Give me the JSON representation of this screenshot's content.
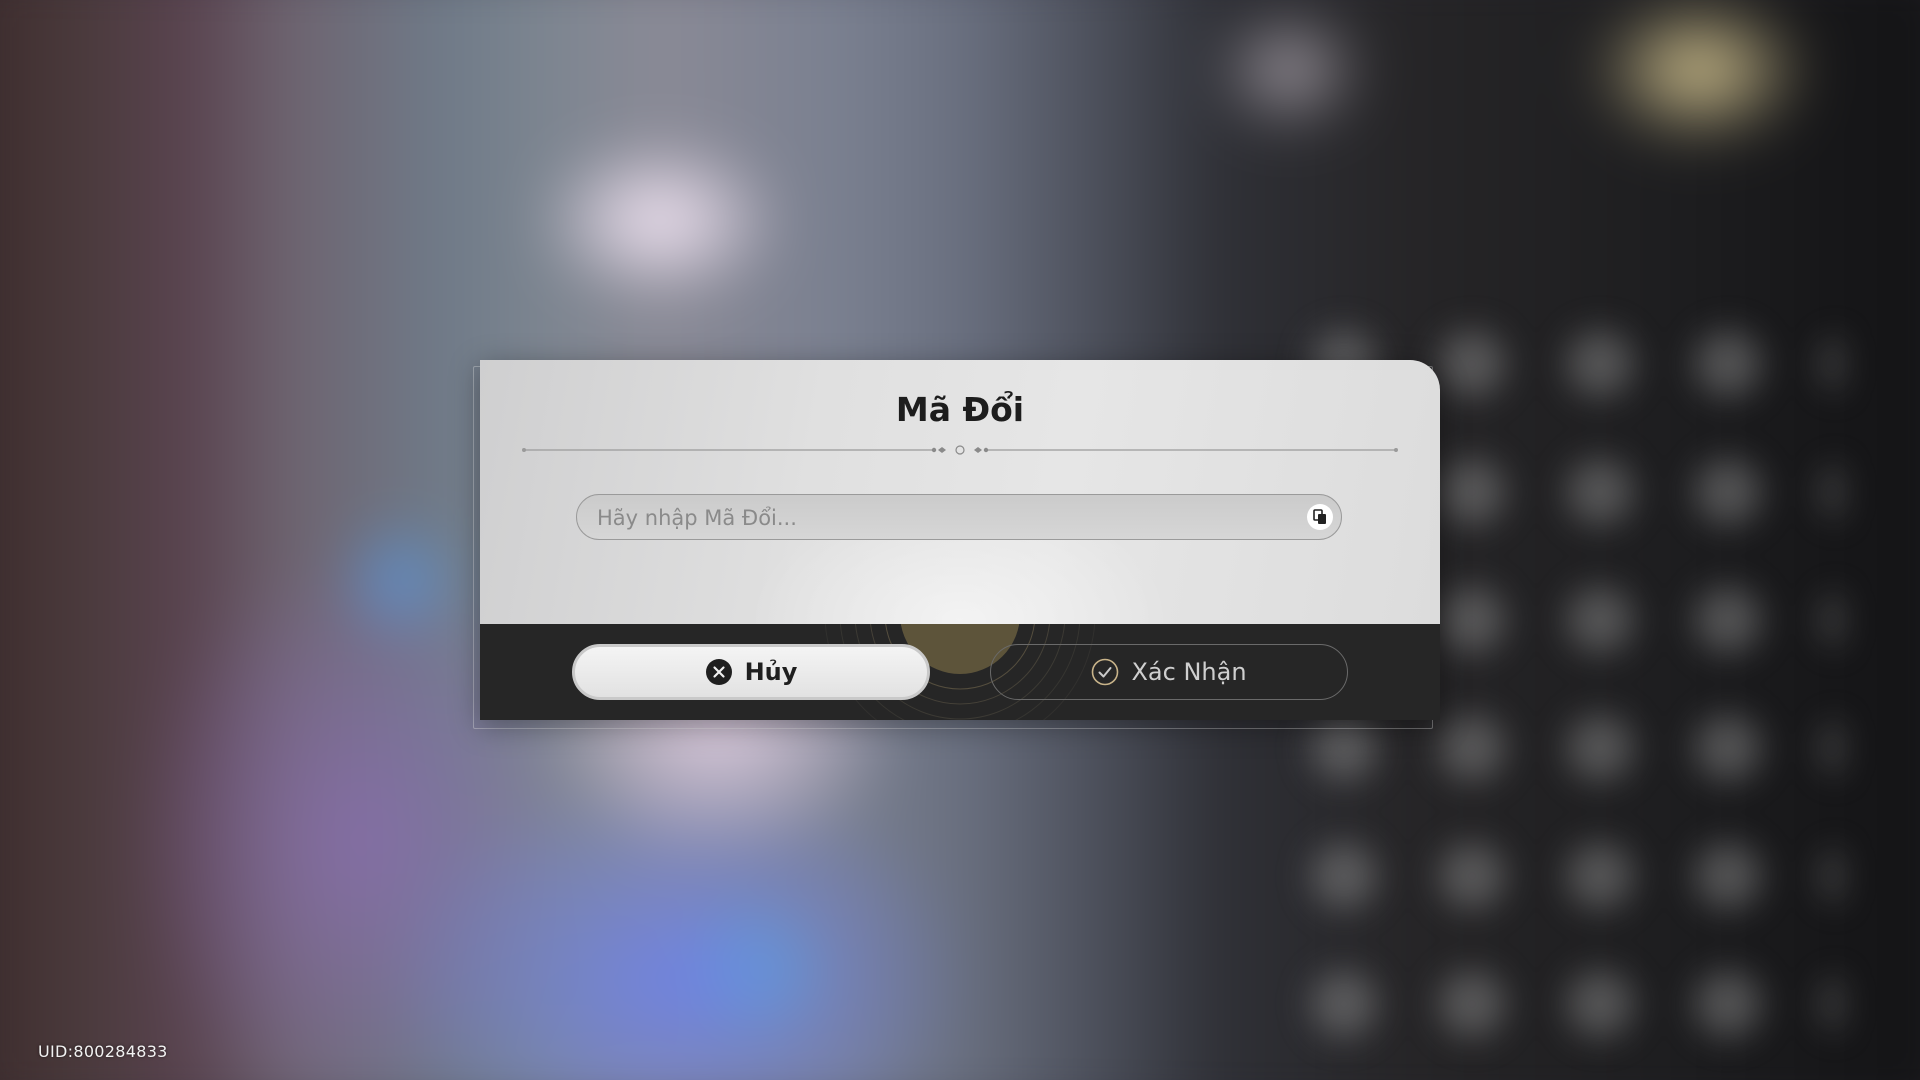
{
  "dialog": {
    "title": "Mã Đổi",
    "input": {
      "value": "",
      "placeholder": "Hãy nhập Mã Đổi..."
    },
    "paste_icon": "paste-icon",
    "cancel_button": {
      "label": "Hủy",
      "icon": "close-circle-icon"
    },
    "confirm_button": {
      "label": "Xác Nhận",
      "icon": "check-circle-icon"
    }
  },
  "footer": {
    "uid": "UID:800284833"
  },
  "colors": {
    "dialog_top": "#e2e2e2",
    "dialog_bottom": "#262626",
    "title_text": "#1d1d1d",
    "cancel_bg": "#eeeeee",
    "confirm_border": "#6a6a6a",
    "confirm_text": "#cfcfcf",
    "accent_gold": "#c9b48a"
  }
}
